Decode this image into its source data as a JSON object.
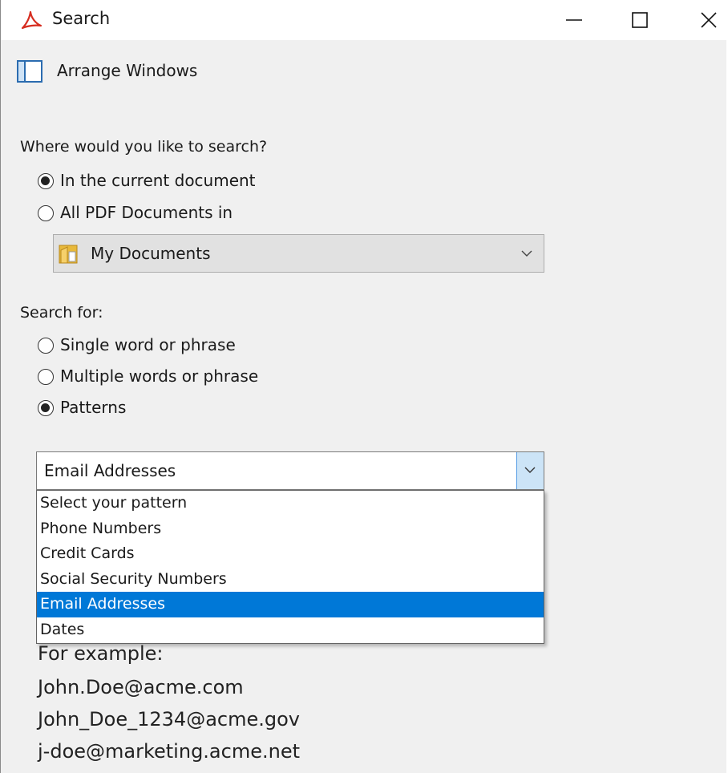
{
  "window": {
    "title": "Search",
    "app_icon": "acrobat-icon"
  },
  "arrange": {
    "label": "Arrange Windows",
    "icon": "arrange-windows-icon"
  },
  "location": {
    "question": "Where would you like to search?",
    "options": [
      {
        "label": "In the current document",
        "checked": true
      },
      {
        "label": "All PDF Documents in",
        "checked": false
      }
    ],
    "folder": "My Documents",
    "folder_icon": "folder-icon"
  },
  "search_for": {
    "label": "Search for:",
    "options": [
      {
        "label": "Single word or phrase",
        "checked": false
      },
      {
        "label": "Multiple words or phrase",
        "checked": false
      },
      {
        "label": "Patterns",
        "checked": true
      }
    ]
  },
  "pattern": {
    "selected": "Email Addresses",
    "options": [
      "Select your pattern",
      "Phone Numbers",
      "Credit Cards",
      "Social Security Numbers",
      "Email Addresses",
      "Dates"
    ],
    "highlighted_index": 4
  },
  "example": {
    "heading": "For example:",
    "lines": [
      "John.Doe@acme.com",
      "John_Doe_1234@acme.gov",
      "j-doe@marketing.acme.net"
    ]
  },
  "colors": {
    "highlight": "#0078d7",
    "acrobat_red": "#d62d20"
  }
}
